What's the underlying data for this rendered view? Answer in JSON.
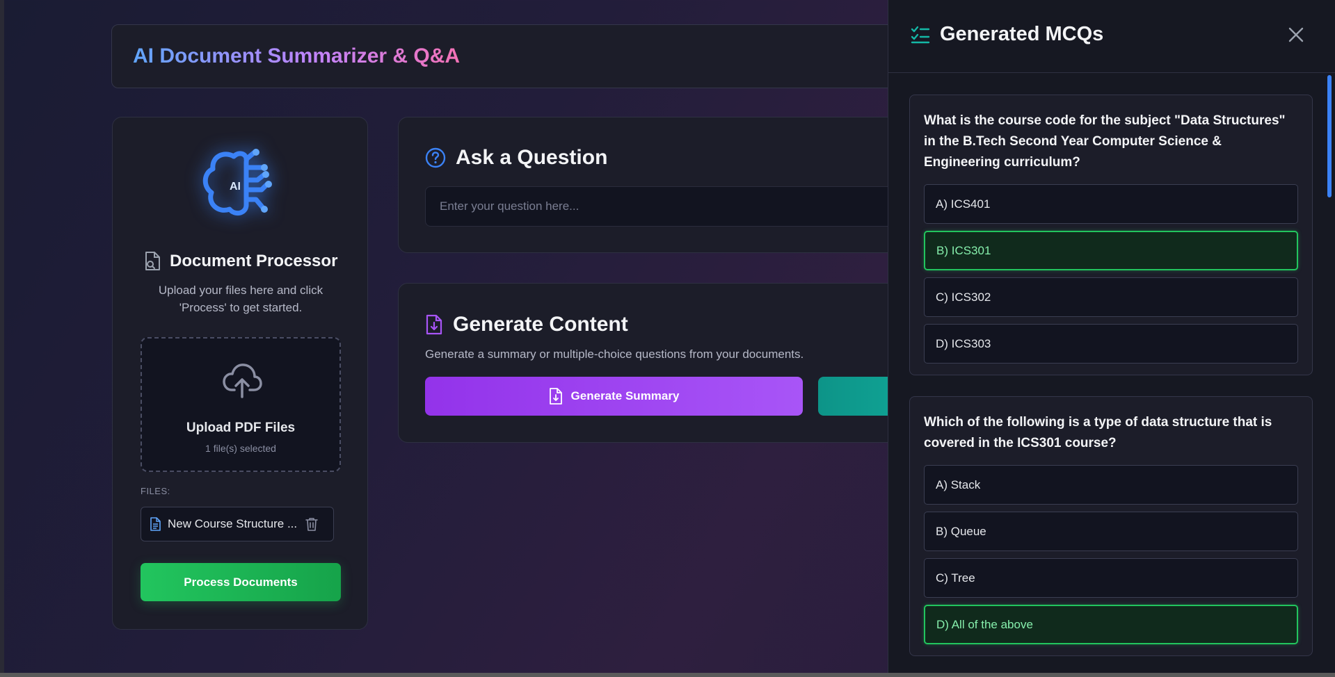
{
  "header": {
    "title": "AI Document Summarizer & Q&A"
  },
  "doc_processor": {
    "logo_text": "AI",
    "title": "Document Processor",
    "subtitle": "Upload your files here and click 'Process' to get started.",
    "upload_label": "Upload PDF Files",
    "upload_count": "1 file(s) selected",
    "files_label": "FILES:",
    "files": [
      "New Course Structure ..."
    ],
    "process_label": "Process Documents"
  },
  "ask": {
    "title": "Ask a Question",
    "placeholder": "Enter your question here..."
  },
  "generate": {
    "title": "Generate Content",
    "description": "Generate a summary or multiple-choice questions from your documents.",
    "summary_label": "Generate Summary"
  },
  "mcq_panel": {
    "title": "Generated MCQs",
    "questions": [
      {
        "question": "What is the course code for the subject \"Data Structures\" in the B.Tech Second Year Computer Science & Engineering curriculum?",
        "options": [
          "A) ICS401",
          "B) ICS301",
          "C) ICS302",
          "D) ICS303"
        ],
        "correct_index": 1
      },
      {
        "question": "Which of the following is a type of data structure that is covered in the ICS301 course?",
        "options": [
          "A) Stack",
          "B) Queue",
          "C) Tree",
          "D) All of the above"
        ],
        "correct_index": 3
      }
    ]
  },
  "colors": {
    "accent_blue": "#3b82f6",
    "accent_purple": "#a855f7",
    "accent_green": "#22c55e",
    "accent_teal": "#14b8a6"
  }
}
